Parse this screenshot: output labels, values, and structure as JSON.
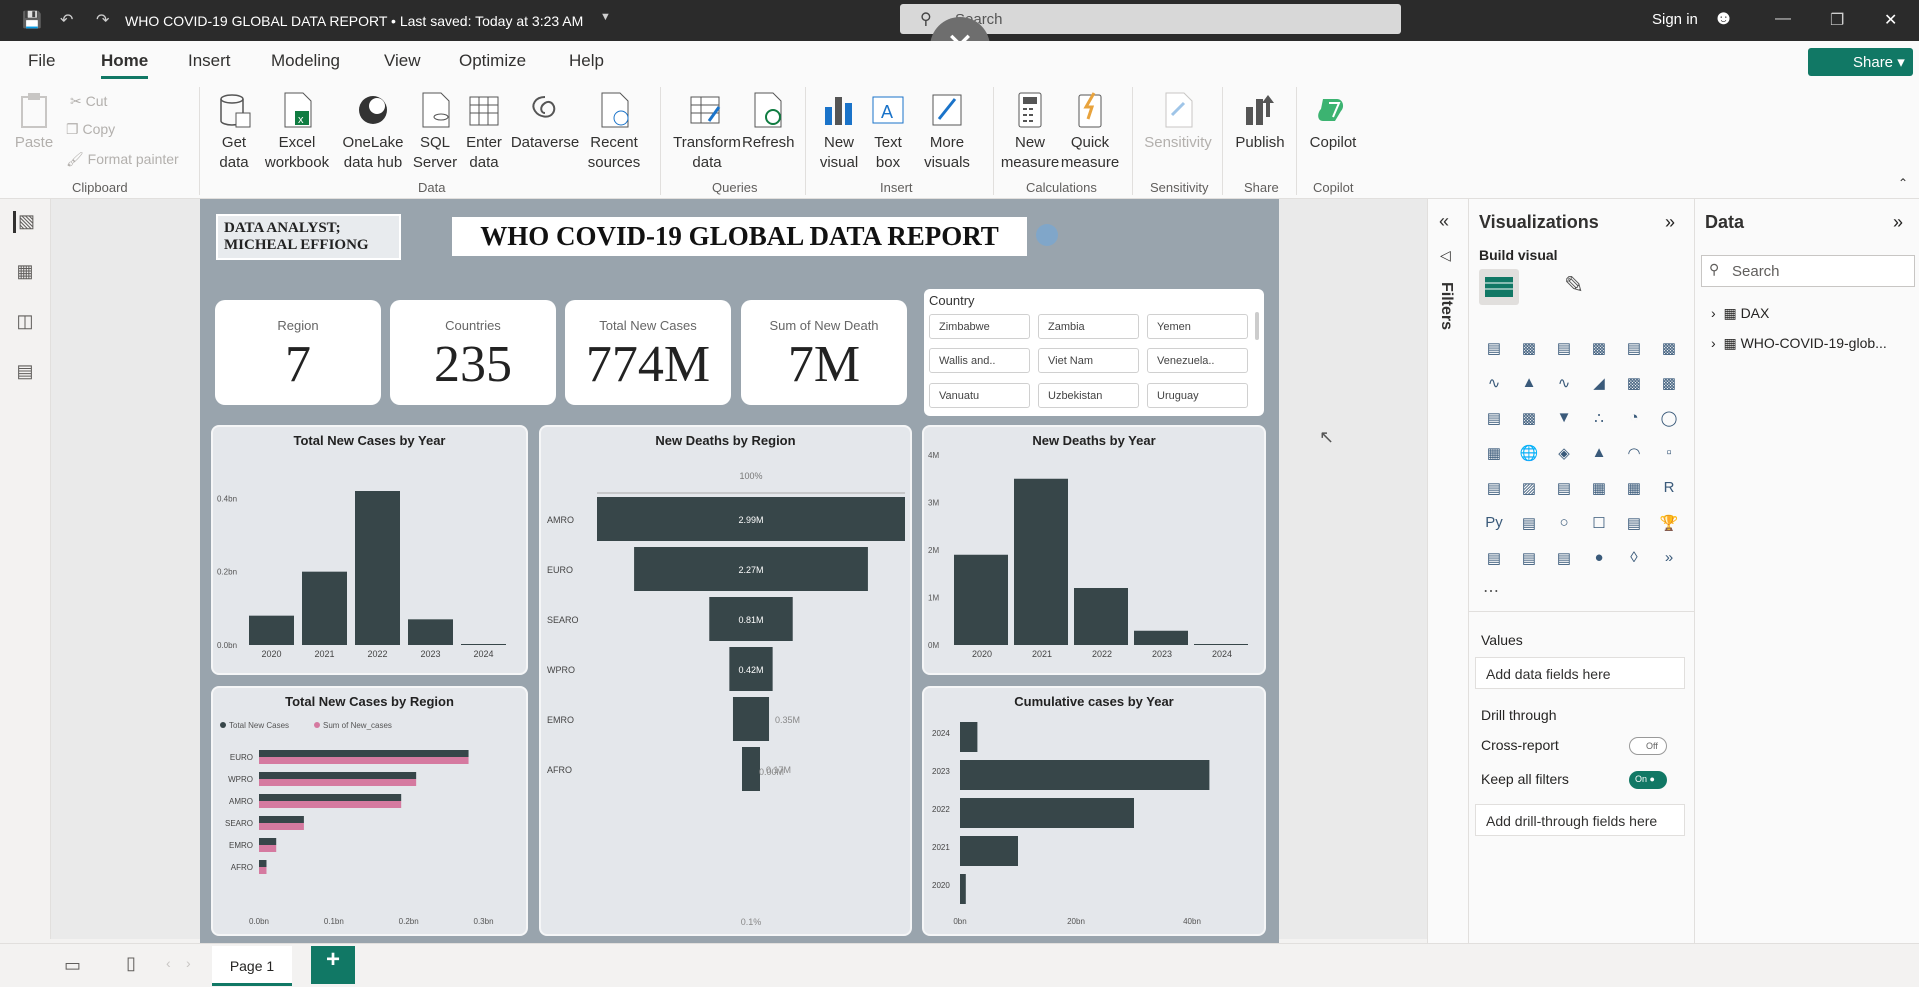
{
  "window": {
    "title": "WHO COVID-19 GLOBAL DATA REPORT • Last saved: Today at 3:23 AM",
    "search_placeholder": "Search",
    "signin": "Sign in"
  },
  "menu": [
    "File",
    "Home",
    "Insert",
    "Modeling",
    "View",
    "Optimize",
    "Help"
  ],
  "share_label": "Share",
  "ribbon": {
    "clipboard": {
      "paste": "Paste",
      "cut": "Cut",
      "copy": "Copy",
      "format_painter": "Format painter",
      "group": "Clipboard"
    },
    "data": {
      "get_data": "Get data",
      "excel": "Excel workbook",
      "onelake": "OneLake data hub",
      "sql": "SQL Server",
      "enter": "Enter data",
      "dataverse": "Dataverse",
      "recent": "Recent sources",
      "group": "Data"
    },
    "queries": {
      "transform": "Transform data",
      "refresh": "Refresh",
      "group": "Queries"
    },
    "insert": {
      "new_visual": "New visual",
      "text_box": "Text box",
      "more_visuals": "More visuals",
      "group": "Insert"
    },
    "calculations": {
      "new_measure": "New measure",
      "quick_measure": "Quick measure",
      "group": "Calculations"
    },
    "sensitivity": {
      "label": "Sensitivity",
      "group": "Sensitivity"
    },
    "share": {
      "publish": "Publish",
      "group": "Share"
    },
    "copilot": {
      "label": "Copilot",
      "group": "Copilot"
    }
  },
  "report": {
    "analyst": "DATA ANALYST; MICHEAL EFFIONG",
    "title": "WHO COVID-19 GLOBAL DATA REPORT",
    "cards": [
      {
        "label": "Region",
        "value": "7"
      },
      {
        "label": "Countries",
        "value": "235"
      },
      {
        "label": "Total New Cases",
        "value": "774M"
      },
      {
        "label": "Sum of New Death",
        "value": "7M"
      }
    ],
    "slicer": {
      "title": "Country",
      "items": [
        "Zimbabwe",
        "Zambia",
        "Yemen",
        "Wallis and..",
        "Viet Nam",
        "Venezuela..",
        "Vanuatu",
        "Uzbekistan",
        "Uruguay"
      ]
    }
  },
  "chart_data": [
    {
      "type": "bar",
      "title": "Total New Cases by Year",
      "categories": [
        "2020",
        "2021",
        "2022",
        "2023",
        "2024"
      ],
      "values": [
        0.08,
        0.2,
        0.42,
        0.07,
        0.002
      ],
      "ytick_labels": [
        "0.0bn",
        "0.2bn",
        "0.4bn"
      ],
      "ylim": [
        0,
        0.45
      ],
      "unit": "bn"
    },
    {
      "type": "bar",
      "title": "New Deaths by Region",
      "categories": [
        "AMRO",
        "EURO",
        "SEARO",
        "WPRO",
        "EMRO",
        "AFRO"
      ],
      "values": [
        2.99,
        2.27,
        0.81,
        0.42,
        0.35,
        0.17
      ],
      "labels": [
        "2.99M",
        "2.27M",
        "0.81M",
        "0.42M",
        "0.35M",
        "0.17M"
      ],
      "extra_labels": [
        "100%",
        "0.00M",
        "0.1%"
      ]
    },
    {
      "type": "bar",
      "title": "New Deaths by Year",
      "categories": [
        "2020",
        "2021",
        "2022",
        "2023",
        "2024"
      ],
      "values": [
        1.9,
        3.5,
        1.2,
        0.3,
        0.02
      ],
      "ytick_labels": [
        "0M",
        "1M",
        "2M",
        "3M",
        "4M"
      ],
      "ylim": [
        0,
        4
      ]
    },
    {
      "type": "bar",
      "title": "Total New Cases by Region",
      "categories": [
        "EURO",
        "WPRO",
        "AMRO",
        "SEARO",
        "EMRO",
        "AFRO"
      ],
      "series": [
        {
          "name": "Total New Cases",
          "values": [
            0.28,
            0.21,
            0.19,
            0.06,
            0.023,
            0.01
          ]
        },
        {
          "name": "Sum of New_cases",
          "values": [
            0.28,
            0.21,
            0.19,
            0.06,
            0.023,
            0.01
          ]
        }
      ],
      "xtick_labels": [
        "0.0bn",
        "0.1bn",
        "0.2bn",
        "0.3bn"
      ],
      "xlim": [
        0,
        0.31
      ],
      "colors": [
        "#374649",
        "#d57aa0"
      ]
    },
    {
      "type": "bar",
      "title": "Cumulative cases by Year",
      "categories": [
        "2024",
        "2023",
        "2022",
        "2021",
        "2020"
      ],
      "values": [
        3,
        43,
        30,
        10,
        1
      ],
      "xtick_labels": [
        "0bn",
        "20bn",
        "40bn"
      ],
      "xlim": [
        0,
        50
      ]
    }
  ],
  "visualizations": {
    "title": "Visualizations",
    "build": "Build visual",
    "values": "Values",
    "values_field": "Add data fields here",
    "drill": "Drill through",
    "cross": "Cross-report",
    "cross_state": "Off",
    "keep": "Keep all filters",
    "keep_state": "On",
    "drill_field": "Add drill-through fields here"
  },
  "data_pane": {
    "title": "Data",
    "search": "Search",
    "items": [
      "DAX",
      "WHO-COVID-19-glob..."
    ]
  },
  "filters_label": "Filters",
  "page_tab": "Page 1",
  "colors": {
    "accent": "#117865",
    "bar": "#374649",
    "pink": "#d57aa0"
  }
}
